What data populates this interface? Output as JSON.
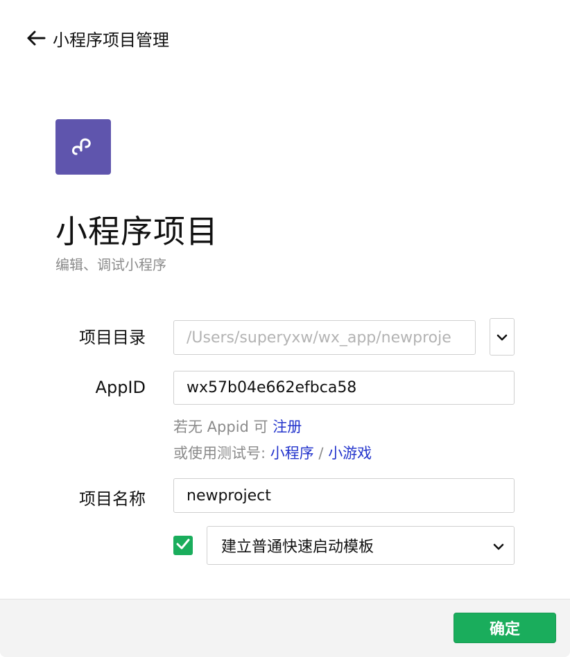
{
  "header": {
    "title": "小程序项目管理",
    "back_icon": "arrow-left-icon"
  },
  "project_type": {
    "icon": "miniprogram-logo-icon",
    "icon_color": "#5f55ad",
    "title": "小程序项目",
    "subtitle": "编辑、调试小程序"
  },
  "form": {
    "directory": {
      "label": "项目目录",
      "placeholder": "/Users/superyxw/wx_app/newproje"
    },
    "appid": {
      "label": "AppID",
      "value": "wx57b04e662efbca58"
    },
    "appid_hint": {
      "line1_prefix": "若无 Appid 可 ",
      "register_link": "注册",
      "line2_prefix": "或使用测试号: ",
      "miniprogram_link": "小程序",
      "separator": " / ",
      "minigame_link": "小游戏"
    },
    "name": {
      "label": "项目名称",
      "value": "newproject"
    },
    "template": {
      "checked": true,
      "selected": "建立普通快速启动模板"
    }
  },
  "footer": {
    "confirm_label": "确定"
  },
  "colors": {
    "accent_green": "#1aad5c",
    "link_blue": "#2233cc",
    "brand_purple": "#5f55ad"
  }
}
